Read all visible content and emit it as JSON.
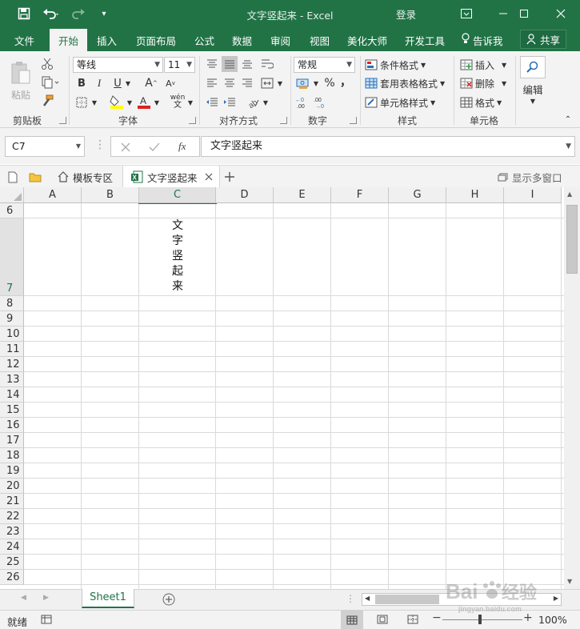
{
  "window": {
    "title": "文字竖起来 - Excel",
    "login_label": "登录"
  },
  "menu": {
    "items": [
      "文件",
      "开始",
      "插入",
      "页面布局",
      "公式",
      "数据",
      "审阅",
      "视图",
      "美化大师",
      "开发工具"
    ],
    "active": "开始",
    "tell_me": "告诉我",
    "share": "共享"
  },
  "ribbon": {
    "clipboard": {
      "paste_label": "粘贴",
      "group_label": "剪贴板"
    },
    "font": {
      "font_name": "等线",
      "font_size": "11",
      "group_label": "字体",
      "bold": "B",
      "italic": "I",
      "underline": "U",
      "grow": "A",
      "shrink": "A",
      "phonetic": "wén"
    },
    "alignment": {
      "group_label": "对齐方式"
    },
    "number": {
      "format": "常规",
      "percent": "%",
      "comma": "，",
      "group_label": "数字"
    },
    "styles": {
      "conditional": "条件格式",
      "table": "套用表格格式",
      "cell_styles": "单元格样式",
      "group_label": "样式"
    },
    "cells": {
      "insert": "插入",
      "delete": "删除",
      "format": "格式",
      "group_label": "单元格"
    },
    "editing": {
      "label": "编辑"
    }
  },
  "formula_bar": {
    "name_box": "C7",
    "fx": "fx",
    "content": "文字竖起来"
  },
  "doc_tabs": {
    "template_tab": "模板专区",
    "file_tab": "文字竖起来",
    "multi_window": "显示多窗口"
  },
  "sheet": {
    "columns": [
      "A",
      "B",
      "C",
      "D",
      "E",
      "F",
      "G",
      "H",
      "I"
    ],
    "rows": [
      "6",
      "7",
      "8",
      "9",
      "10",
      "11",
      "12",
      "13",
      "14",
      "15",
      "16",
      "17",
      "18",
      "19",
      "20",
      "21",
      "22",
      "23",
      "24",
      "25",
      "26"
    ],
    "cell_c7_chars": [
      "文",
      "字",
      "竖",
      "起",
      "来"
    ]
  },
  "sheet_tabs": {
    "active": "Sheet1"
  },
  "status": {
    "ready": "就绪",
    "zoom": "100%"
  },
  "watermark": "Baidu 经验"
}
